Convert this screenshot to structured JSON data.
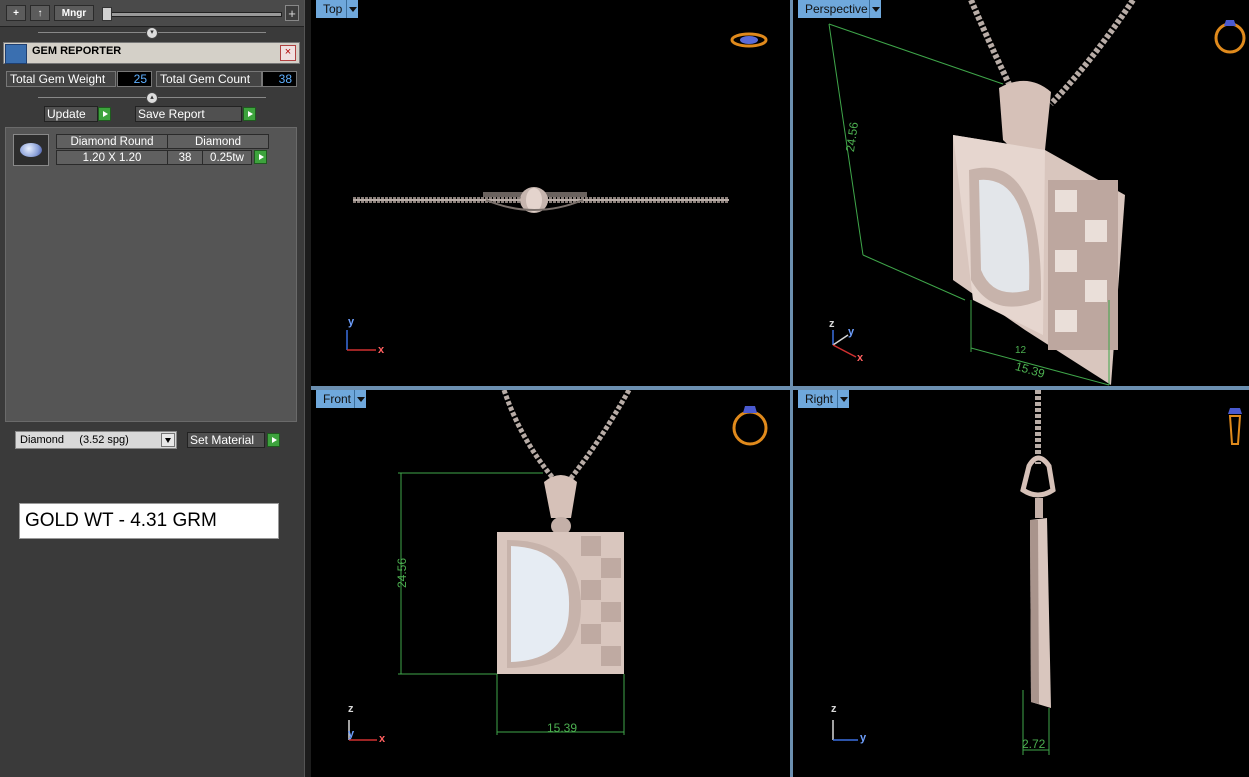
{
  "toolbar": {
    "add_label": "+",
    "up_label": "↑",
    "manager_label": "Mngr",
    "plus_label": "+"
  },
  "gem_reporter": {
    "title": "GEM REPORTER",
    "close_label": "×",
    "total_weight_label": "Total Gem Weight",
    "total_weight_value": "25",
    "total_count_label": "Total Gem Count",
    "total_count_value": "38",
    "update_label": "Update",
    "save_report_label": "Save Report",
    "table": {
      "headers": [
        "Diamond Round",
        "Diamond"
      ],
      "row": {
        "size": "1.20 X 1.20",
        "count": "38",
        "weight": "0.25tw"
      }
    },
    "material_select": "Diamond     (3.52 spg)",
    "set_material_label": "Set Material"
  },
  "gold_weight": "GOLD WT - 4.31 GRM",
  "viewports": {
    "top": {
      "label": "Top"
    },
    "perspective": {
      "label": "Perspective",
      "dim_height": "24.56",
      "dim_width": "15.39",
      "dim_small": "12"
    },
    "front": {
      "label": "Front",
      "dim_height": "24.56",
      "dim_width": "15.39"
    },
    "right": {
      "label": "Right",
      "dim_width": "2.72"
    }
  },
  "axes": {
    "x": "x",
    "y": "y",
    "z": "z"
  },
  "colors": {
    "accent": "#6fa8dc",
    "dimension": "#4caf50",
    "metal": "#c9a99a",
    "ring_icon": "#e08a1c"
  }
}
